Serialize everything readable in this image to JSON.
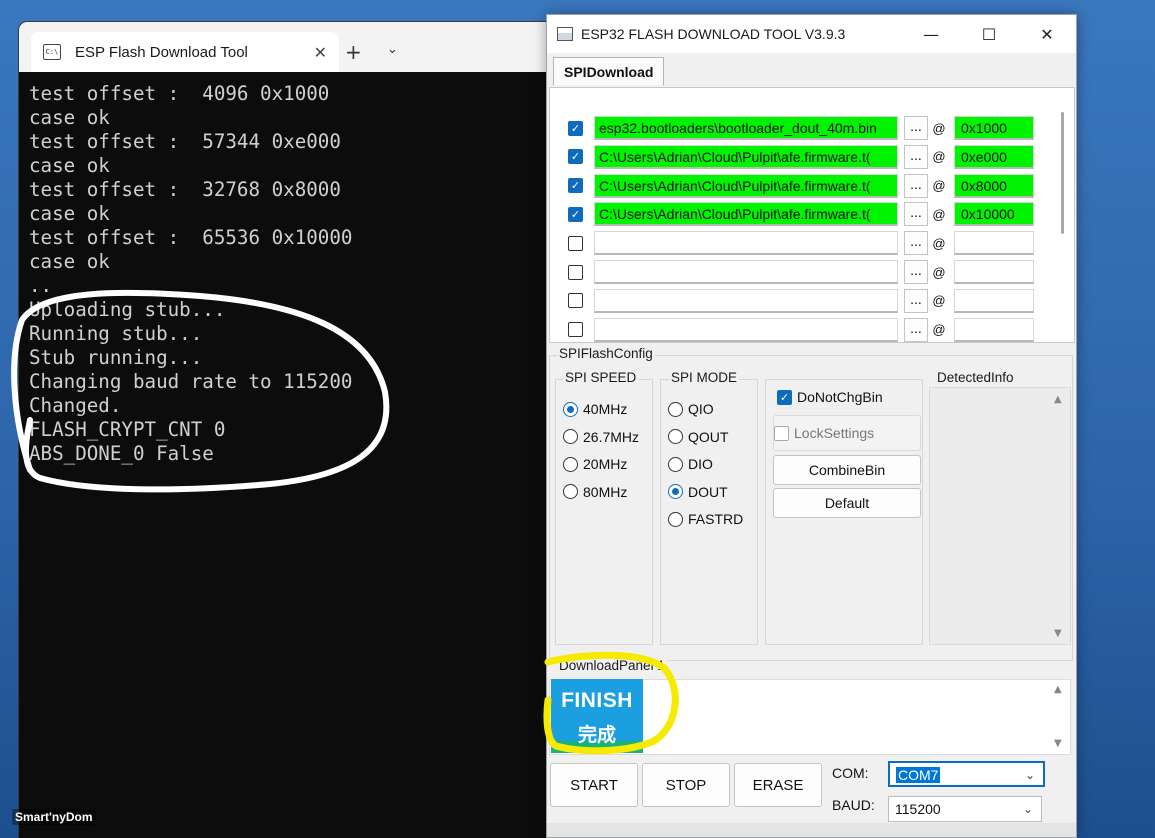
{
  "terminal": {
    "tab_title": "ESP Flash Download Tool",
    "tab_icon_text": "C:\\",
    "close_glyph": "✕",
    "new_tab_glyph": "+",
    "dropdown_glyph": "⌄",
    "lines": [
      "test offset :  4096 0x1000",
      "case ok",
      "test offset :  57344 0xe000",
      "case ok",
      "test offset :  32768 0x8000",
      "case ok",
      "test offset :  65536 0x10000",
      "case ok",
      "..",
      "Uploading stub...",
      "Running stub...",
      "Stub running...",
      "Changing baud rate to 115200",
      "Changed.",
      "FLASH_CRYPT_CNT 0",
      "ABS_DONE_0 False"
    ]
  },
  "tool": {
    "window_title": "ESP32 FLASH DOWNLOAD TOOL V3.9.3",
    "window_controls": {
      "minimize": "—",
      "maximize": "☐",
      "close": "✕"
    },
    "tab_label": "SPIDownload",
    "files": [
      {
        "checked": true,
        "path": "esp32.bootloaders\\bootloader_dout_40m.bin",
        "browse": "...",
        "at": "@",
        "offset": "0x1000"
      },
      {
        "checked": true,
        "path": "C:\\Users\\Adrian\\Cloud\\Pulpit\\afe.firmware.t(",
        "browse": "...",
        "at": "@",
        "offset": "0xe000"
      },
      {
        "checked": true,
        "path": "C:\\Users\\Adrian\\Cloud\\Pulpit\\afe.firmware.t(",
        "browse": "...",
        "at": "@",
        "offset": "0x8000"
      },
      {
        "checked": true,
        "path": "C:\\Users\\Adrian\\Cloud\\Pulpit\\afe.firmware.t(",
        "browse": "...",
        "at": "@",
        "offset": "0x10000"
      },
      {
        "checked": false,
        "path": "",
        "browse": "...",
        "at": "@",
        "offset": ""
      },
      {
        "checked": false,
        "path": "",
        "browse": "...",
        "at": "@",
        "offset": ""
      },
      {
        "checked": false,
        "path": "",
        "browse": "...",
        "at": "@",
        "offset": ""
      },
      {
        "checked": false,
        "path": "",
        "browse": "...",
        "at": "@",
        "offset": ""
      }
    ],
    "spi_flash_config_label": "SPIFlashConfig",
    "spi_speed": {
      "label": "SPI SPEED",
      "options": [
        "40MHz",
        "26.7MHz",
        "20MHz",
        "80MHz"
      ],
      "selected": "40MHz"
    },
    "spi_mode": {
      "label": "SPI MODE",
      "options": [
        "QIO",
        "QOUT",
        "DIO",
        "DOUT",
        "FASTRD"
      ],
      "selected": "DOUT"
    },
    "do_not_chg_bin": {
      "label": "DoNotChgBin",
      "checked": true
    },
    "lock_settings": {
      "label": "LockSettings",
      "checked": false
    },
    "combine_bin_label": "CombineBin",
    "default_label": "Default",
    "detected_info_label": "DetectedInfo",
    "download_panel_label": "DownloadPanel 1",
    "finish_en": "FINISH",
    "finish_cn": "完成",
    "start_label": "START",
    "stop_label": "STOP",
    "erase_label": "ERASE",
    "com_label": "COM:",
    "com_value": "COM7",
    "baud_label": "BAUD:",
    "baud_value": "115200"
  },
  "watermark": "Smart'nyDom",
  "colors": {
    "highlight_green": "#00f400",
    "finish_blue": "#1b9fe0",
    "accent": "#0f6cbd",
    "annotation_yellow": "#f5ea00",
    "annotation_white": "#ffffff"
  }
}
